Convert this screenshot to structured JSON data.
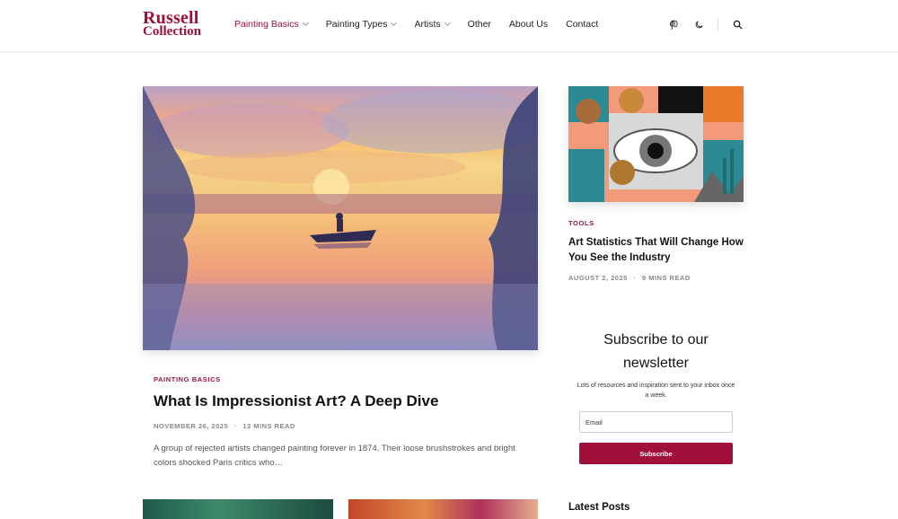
{
  "brand": {
    "line1": "Russell",
    "line2": "Collection",
    "color": "#a0103a"
  },
  "nav": [
    {
      "label": "Painting Basics",
      "dropdown": true,
      "active": true
    },
    {
      "label": "Painting Types",
      "dropdown": true,
      "active": false
    },
    {
      "label": "Artists",
      "dropdown": true,
      "active": false
    },
    {
      "label": "Other",
      "dropdown": false,
      "active": false
    },
    {
      "label": "About Us",
      "dropdown": false,
      "active": false
    },
    {
      "label": "Contact",
      "dropdown": false,
      "active": false
    }
  ],
  "header_icons": [
    "pinterest-icon",
    "dark-mode-moon-icon",
    "search-icon"
  ],
  "featured": {
    "category": "Painting Basics",
    "title": "What Is Impressionist Art? A Deep Dive",
    "date": "November 26, 2025",
    "read_time": "13 Mins Read",
    "excerpt": "A group of rejected artists changed painting forever in 1874. Their loose brushstrokes and bright colors shocked Paris critics who…"
  },
  "sidebar_post": {
    "category": "Tools",
    "title": "Art Statistics That Will Change How You See the Industry",
    "date": "August 2, 2025",
    "read_time": "9 Mins Read"
  },
  "newsletter": {
    "title": "Subscribe to our newsletter",
    "subtitle": "Lots of resources and inspiration sent to your inbox once a week.",
    "email_placeholder": "Email",
    "button_label": "Subscribe"
  },
  "latest_posts_heading": "Latest Posts",
  "meta_separator": "·"
}
